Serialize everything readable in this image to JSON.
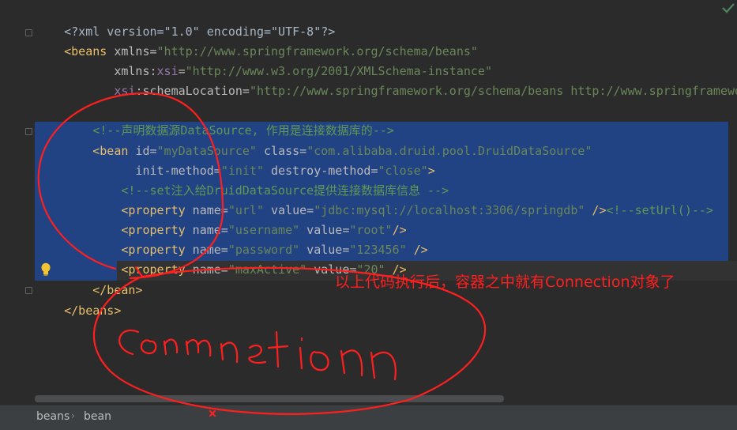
{
  "editor": {
    "lines": {
      "l1": "<?xml version=\"1.0\" encoding=\"UTF-8\"?>",
      "l2a": "<beans",
      "l2b": " xmlns=",
      "l2c": "\"http://www.springframework.org/schema/beans\"",
      "l3a": "       xmlns:",
      "l3b": "xsi",
      "l3c": "=",
      "l3d": "\"http://www.w3.org/2001/XMLSchema-instance\"",
      "l4a": "       ",
      "l4b": "xsi",
      "l4c": ":schemaLocation=",
      "l4d": "\"http://www.springframework.org/schema/beans http://www.springframewo",
      "l6": "    <!--声明数据源DataSource, 作用是连接数据库的-->",
      "l7a": "    <bean",
      "l7b": " id=",
      "l7c": "\"myDataSource\"",
      "l7d": " class=",
      "l7e": "\"com.alibaba.druid.pool.DruidDataSource\"",
      "l8a": "          init-method=",
      "l8b": "\"init\"",
      "l8c": " destroy-method=",
      "l8d": "\"close\"",
      "l8e": ">",
      "l9": "        <!--set注入给DruidDataSource提供连接数据库信息 -->",
      "p1a": "        <property",
      "p1b": " name=",
      "p1c": "\"url\"",
      "p1d": " value=",
      "p1e": "\"jdbc:mysql://localhost:3306/springdb\"",
      "p1f": " />",
      "p1g": "<!--setUrl()-->",
      "p2a": "        <property",
      "p2b": " name=",
      "p2c": "\"username\"",
      "p2d": " value=",
      "p2e": "\"root\"",
      "p2f": "/>",
      "p3a": "        <property",
      "p3b": " name=",
      "p3c": "\"password\"",
      "p3d": " value=",
      "p3e": "\"123456\"",
      "p3f": " />",
      "p4a": "        <property",
      "p4b": " name=",
      "p4c": "\"maxActive\"",
      "p4d": " value=",
      "p4e": "\"20\"",
      "p4f": " />",
      "l14": "    </bean>",
      "l15": "</beans>"
    }
  },
  "annotation": {
    "text": "以上代码执行后，容器之中就有Connection对象了",
    "color": "#ff1f1f"
  },
  "breadcrumb": {
    "items": [
      "beans",
      "bean"
    ],
    "separator": "›"
  },
  "icons": {
    "gutter_bulb": "lightbulb-icon",
    "inspection": "check-icon"
  },
  "colors": {
    "background": "#2b2b2b",
    "selection": "#214283",
    "tag": "#e8bf6a",
    "value": "#6a8759",
    "comment": "#629755",
    "namespace": "#9876aa",
    "ink": "#ff1f1f"
  }
}
